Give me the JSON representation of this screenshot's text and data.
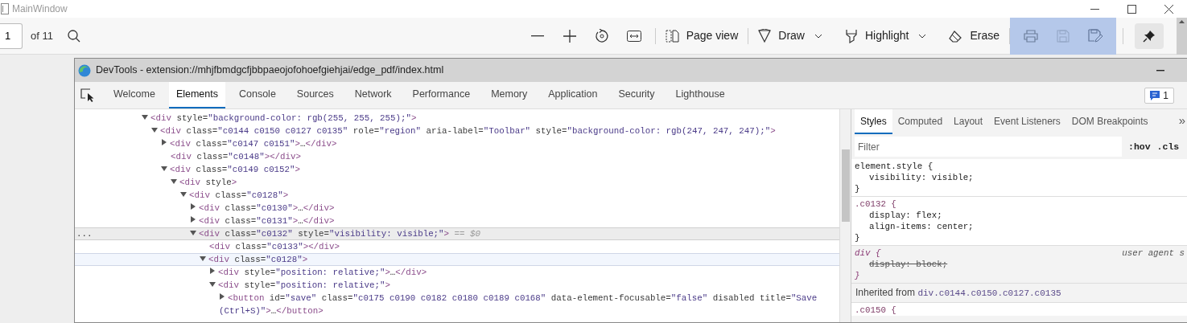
{
  "window": {
    "title": "MainWindow"
  },
  "pdf_toolbar": {
    "page_number": "1",
    "page_count": "of 11",
    "page_view": "Page view",
    "draw": "Draw",
    "highlight": "Highlight",
    "erase": "Erase",
    "file_buttons": {
      "highlighted": true,
      "save": {
        "disabled": true
      }
    },
    "pin": {
      "pressed": true
    }
  },
  "devtools": {
    "title": "DevTools - extension://mhjfbmdgcfjbbpaeojofohoefgiehjai/edge_pdf/index.html",
    "tabs": [
      {
        "label": "Welcome",
        "selected": false
      },
      {
        "label": "Elements",
        "selected": true
      },
      {
        "label": "Console",
        "selected": false
      },
      {
        "label": "Sources",
        "selected": false
      },
      {
        "label": "Network",
        "selected": false
      },
      {
        "label": "Performance",
        "selected": false
      },
      {
        "label": "Memory",
        "selected": false
      },
      {
        "label": "Application",
        "selected": false
      },
      {
        "label": "Security",
        "selected": false
      },
      {
        "label": "Lighthouse",
        "selected": false
      }
    ],
    "issues_count": "1",
    "dom_tree": [
      {
        "markup": "<div style=\"background-color: rgb(255, 255, 255);\">",
        "kind": "toggle",
        "expanded": true,
        "selected": false,
        "hovered": false,
        "children": [
          {
            "markup": "<div class=\"c0144 c0150 c0127 c0135\" role=\"region\" aria-label=\"Toolbar\" style=\"background-color: rgb(247, 247, 247);\">",
            "kind": "toggle",
            "expanded": true,
            "selected": false,
            "hovered": false,
            "children": [
              {
                "markup": "<div class=\"c0147 c0151\">…</div>",
                "kind": "toggle",
                "expanded": false,
                "selected": false,
                "hovered": false
              },
              {
                "markup": "<div class=\"c0148\"></div>",
                "kind": "leaf",
                "selected": false,
                "hovered": false
              },
              {
                "markup": "<div class=\"c0149 c0152\">",
                "kind": "toggle",
                "expanded": true,
                "selected": false,
                "hovered": false,
                "children": [
                  {
                    "markup": "<div style>",
                    "kind": "toggle",
                    "expanded": true,
                    "selected": false,
                    "hovered": false,
                    "children": [
                      {
                        "markup": "<div class=\"c0128\">",
                        "kind": "toggle",
                        "expanded": true,
                        "selected": false,
                        "hovered": false,
                        "children": [
                          {
                            "markup": "<div class=\"c0130\">…</div>",
                            "kind": "toggle",
                            "expanded": false,
                            "selected": false,
                            "hovered": false
                          },
                          {
                            "markup": "<div class=\"c0131\">…</div>",
                            "kind": "toggle",
                            "expanded": false,
                            "selected": false,
                            "hovered": false
                          },
                          {
                            "markup": "<div class=\"c0132\" style=\"visibility: visible;\">",
                            "kind": "toggle",
                            "expanded": true,
                            "selected": true,
                            "hovered": false,
                            "menu_dots": "...",
                            "console_ref": "== $0",
                            "children": [
                              {
                                "markup": "<div class=\"c0133\"></div>",
                                "kind": "leaf",
                                "selected": false,
                                "hovered": false
                              },
                              {
                                "markup": "<div class=\"c0128\">",
                                "kind": "toggle",
                                "expanded": true,
                                "selected": false,
                                "hovered": true,
                                "children": [
                                  {
                                    "markup": "<div style=\"position: relative;\">…</div>",
                                    "kind": "toggle",
                                    "expanded": false,
                                    "selected": false,
                                    "hovered": false
                                  },
                                  {
                                    "markup": "<div style=\"position: relative;\">",
                                    "kind": "toggle",
                                    "expanded": true,
                                    "selected": false,
                                    "hovered": false,
                                    "children": [
                                      {
                                        "markup": "<button id=\"save\" class=\"c0175 c0190 c0182 c0180 c0189 c0168\" data-element-focusable=\"false\" disabled title=\"Save (Ctrl+S)\">…</button>",
                                        "kind": "toggle",
                                        "expanded": false,
                                        "selected": false,
                                        "hovered": false
                                      }
                                    ]
                                  }
                                ]
                              }
                            ]
                          }
                        ]
                      }
                    ]
                  }
                ]
              }
            ]
          }
        ]
      }
    ],
    "styles": {
      "tabs": [
        {
          "label": "Styles",
          "selected": true
        },
        {
          "label": "Computed",
          "selected": false
        },
        {
          "label": "Layout",
          "selected": false
        },
        {
          "label": "Event Listeners",
          "selected": false
        },
        {
          "label": "DOM Breakpoints",
          "selected": false
        }
      ],
      "more": "»",
      "filter": {
        "placeholder": "Filter"
      },
      "hov": ":hov",
      "cls": ".cls",
      "rules": [
        {
          "kind": "inline",
          "header": "element.style {",
          "declarations": [
            {
              "text": "visibility: visible;",
              "overridden": false
            }
          ],
          "footer": "}"
        },
        {
          "kind": "author",
          "header": ".c0132 {",
          "declarations": [
            {
              "text": "display: flex;",
              "overridden": false
            },
            {
              "text": "align-items: center;",
              "overridden": false
            }
          ],
          "footer": "}"
        },
        {
          "kind": "user_agent",
          "header": "div {",
          "origin": "user agent s",
          "declarations": [
            {
              "text": "display: block;",
              "overridden": true
            }
          ],
          "footer": "}"
        }
      ],
      "inherited": {
        "label": "Inherited from",
        "link": "div.c0144.c0150.c0127.c0135"
      },
      "inherited_rules": [
        {
          "kind": "author",
          "header": ".c0150 {"
        }
      ]
    }
  }
}
